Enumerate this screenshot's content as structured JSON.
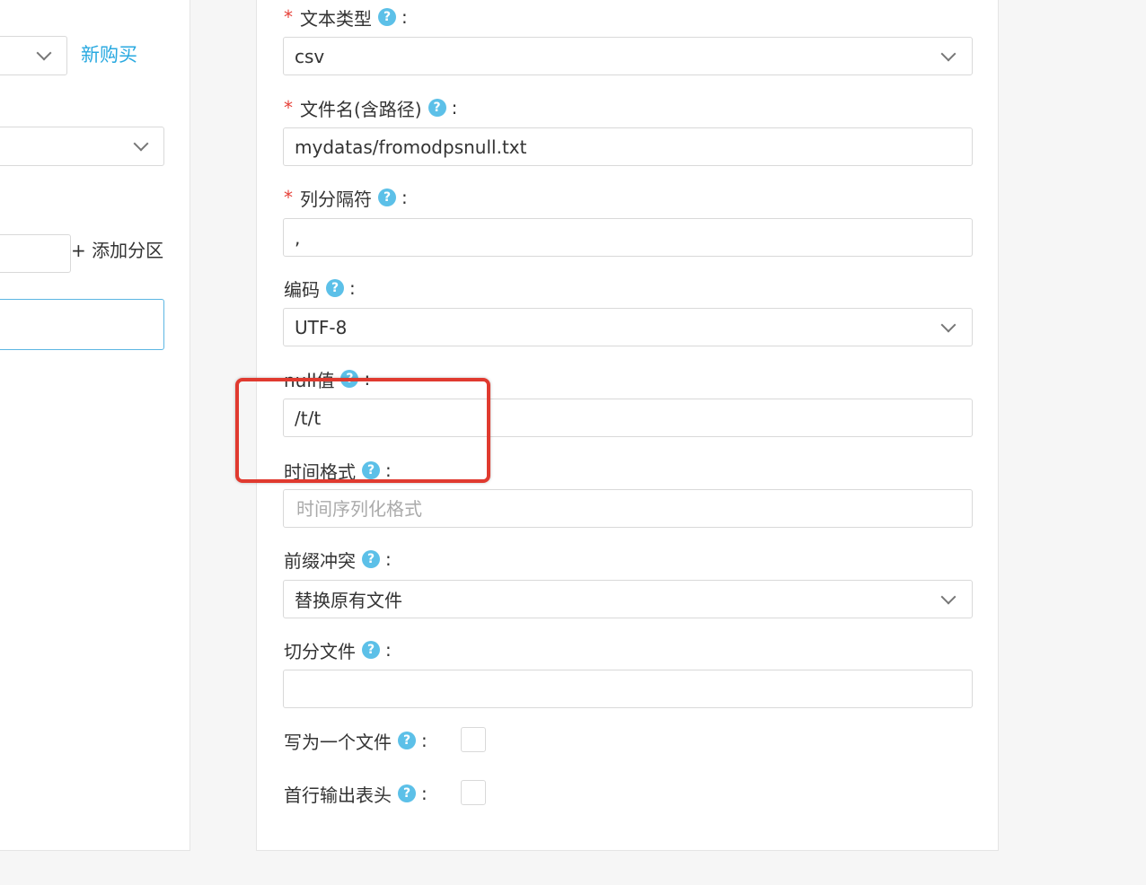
{
  "left": {
    "buy_link": "新购买",
    "add_partition": "+ 添加分区"
  },
  "form": {
    "text_type": {
      "label": "文本类型",
      "value": "csv"
    },
    "file_name": {
      "label": "文件名(含路径)",
      "value": "mydatas/fromodpsnull.txt"
    },
    "column_separator": {
      "label": "列分隔符",
      "value": ","
    },
    "encoding": {
      "label": "编码",
      "value": "UTF-8"
    },
    "null_value": {
      "label": "null值",
      "value": "/t/t"
    },
    "time_format": {
      "label": "时间格式",
      "placeholder": "时间序列化格式"
    },
    "prefix_conflict": {
      "label": "前缀冲突",
      "value": "替换原有文件"
    },
    "split_file": {
      "label": "切分文件",
      "value": ""
    },
    "write_single_file": {
      "label": "写为一个文件"
    },
    "header_first_line": {
      "label": "首行输出表头"
    }
  },
  "ui": {
    "required_mark": "*",
    "help_glyph": "?",
    "colon": ":"
  },
  "colors": {
    "accent": "#29a9e0",
    "help_icon": "#5cc0e8",
    "required": "#e6423a",
    "highlight": "#e03a2f"
  }
}
